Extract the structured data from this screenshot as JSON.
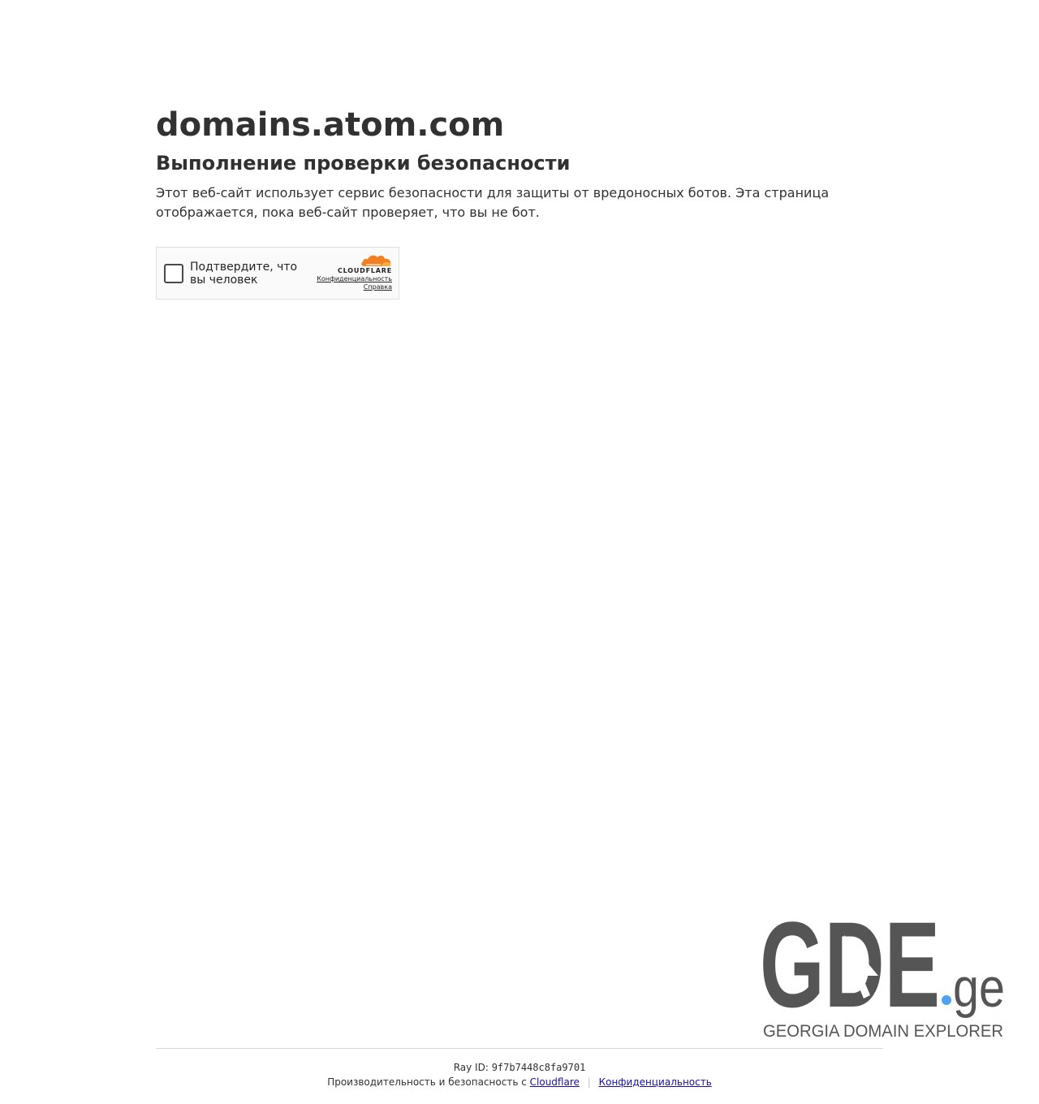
{
  "header": {
    "site_name": "domains.atom.com",
    "title": "Выполнение проверки безопасности",
    "description": "Этот веб-сайт использует сервис безопасности для защиты от вредоносных ботов. Эта страница отображается, пока веб-сайт проверяет, что вы не бот."
  },
  "challenge_widget": {
    "checkbox_label": "Подтвердите, что вы человек",
    "brand": "CLOUDFLARE",
    "privacy_link": "Конфиденциальность",
    "help_link": "Справка",
    "logo_icon": "cloudflare-cloud-icon",
    "logo_color": "#f38020"
  },
  "logo": {
    "text": "GDE",
    "suffix": ".ge",
    "tagline": "GEORGIA DOMAIN EXPLORER",
    "text_color": "#555555",
    "dot_color": "#4da3ee"
  },
  "footer": {
    "ray_label": "Ray ID:",
    "ray_id": "9f7b7448c8fa9701",
    "performance_text": "Производительность и безопасность с",
    "cloudflare_link": "Cloudflare",
    "separator": "|",
    "privacy_link": "Конфиденциальность"
  }
}
